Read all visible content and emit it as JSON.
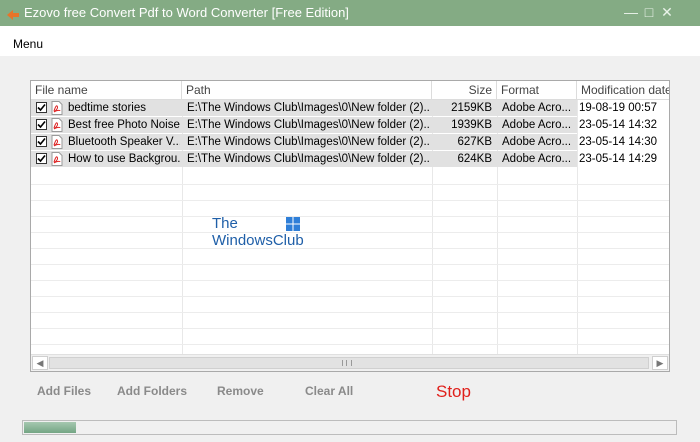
{
  "window": {
    "title": "Ezovo free Convert Pdf to Word Converter [Free Edition]",
    "accent": "#84ab84"
  },
  "menu": {
    "label": "Menu"
  },
  "table": {
    "columns": [
      "File name",
      "Path",
      "Size",
      "Format",
      "Modification date"
    ],
    "rows": [
      {
        "checked": true,
        "name": "bedtime stories",
        "path": "E:\\The Windows Club\\Images\\0\\New folder (2)...",
        "size": "2159KB",
        "format": "Adobe Acro...",
        "date": "19-08-19 00:57"
      },
      {
        "checked": true,
        "name": "Best free Photo Noise...",
        "path": "E:\\The Windows Club\\Images\\0\\New folder (2)...",
        "size": "1939KB",
        "format": "Adobe Acro...",
        "date": "23-05-14 14:32"
      },
      {
        "checked": true,
        "name": "Bluetooth Speaker V...",
        "path": "E:\\The Windows Club\\Images\\0\\New folder (2)...",
        "size": "627KB",
        "format": "Adobe Acro...",
        "date": "23-05-14 14:30"
      },
      {
        "checked": true,
        "name": "How to use Backgrou...",
        "path": "E:\\The Windows Club\\Images\\0\\New folder (2)...",
        "size": "624KB",
        "format": "Adobe Acro...",
        "date": "23-05-14 14:29"
      }
    ],
    "file_icon": "pdf-icon"
  },
  "watermark": {
    "line1": "The",
    "line2": "WindowsClub"
  },
  "actions": {
    "add_files": "Add Files",
    "add_folders": "Add Folders",
    "remove": "Remove",
    "clear_all": "Clear All",
    "stop": "Stop",
    "stop_color": "#e0201b"
  },
  "progress": {
    "fraction": 0.08
  }
}
